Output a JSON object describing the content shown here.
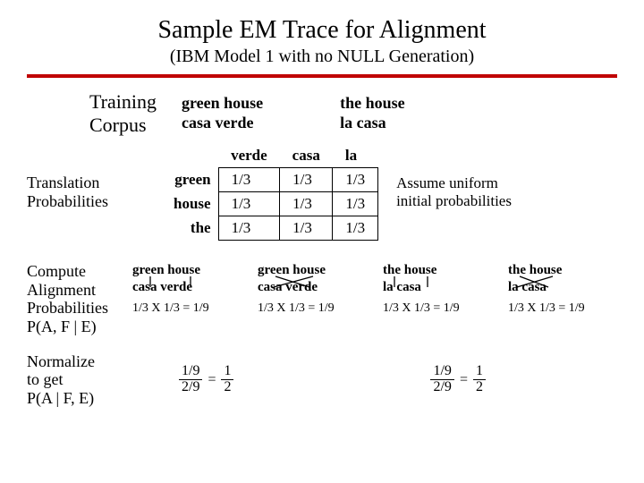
{
  "title": "Sample EM Trace for Alignment",
  "subtitle": "(IBM Model 1 with no NULL Generation)",
  "training_label1": "Training",
  "training_label2": "Corpus",
  "corpus": [
    {
      "en": "green house",
      "fr": "casa verde"
    },
    {
      "en": "the house",
      "fr": "la casa"
    }
  ],
  "prob_label1": "Translation",
  "prob_label2": "Probabilities",
  "note1": "Assume uniform",
  "note2": "initial probabilities",
  "table": {
    "cols": [
      "verde",
      "casa",
      "la"
    ],
    "rows": [
      {
        "h": "green",
        "v": [
          "1/3",
          "1/3",
          "1/3"
        ]
      },
      {
        "h": "house",
        "v": [
          "1/3",
          "1/3",
          "1/3"
        ]
      },
      {
        "h": "the",
        "v": [
          "1/3",
          "1/3",
          "1/3"
        ]
      }
    ]
  },
  "align_label1": "Compute",
  "align_label2": "Alignment",
  "align_label3": "Probabilities",
  "align_label4": "P(A, F | E)",
  "alignments": [
    {
      "en": "green house",
      "fr": "casa verde",
      "calc": "1/3 X 1/3 = 1/9",
      "cross": false
    },
    {
      "en": "green house",
      "fr": "casa verde",
      "calc": "1/3 X 1/3 = 1/9",
      "cross": true
    },
    {
      "en": "the house",
      "fr": "la casa",
      "calc": "1/3 X 1/3 = 1/9",
      "cross": false
    },
    {
      "en": "the house",
      "fr": "la casa",
      "calc": "1/3 X 1/3 = 1/9",
      "cross": true
    }
  ],
  "norm_label1": "Normalize",
  "norm_label2": "to get",
  "norm_label3": "P(A | F, E)",
  "norm_eqs": [
    {
      "n1": "1/9",
      "d1": "2/9",
      "n2": "1",
      "d2": "2"
    },
    {
      "n1": "1/9",
      "d1": "2/9",
      "n2": "1",
      "d2": "2"
    }
  ]
}
